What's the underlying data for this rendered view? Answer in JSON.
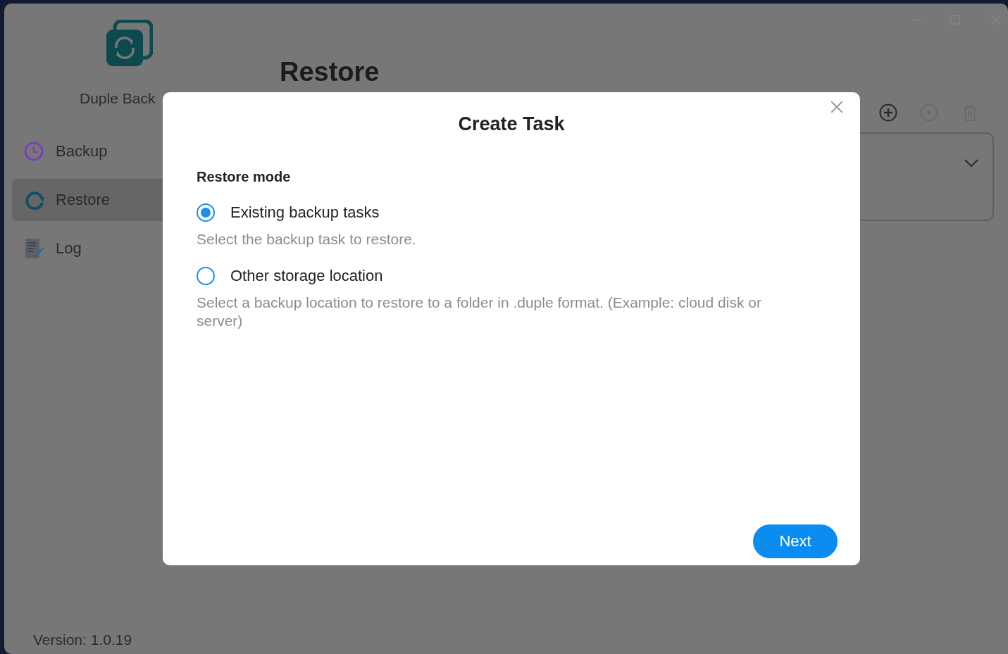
{
  "sidebar": {
    "app_name": "Duple Back",
    "items": [
      {
        "label": "Backup",
        "selected": false
      },
      {
        "label": "Restore",
        "selected": true
      },
      {
        "label": "Log",
        "selected": false
      }
    ],
    "version": "Version: 1.0.19"
  },
  "main": {
    "title": "Restore"
  },
  "dialog": {
    "title": "Create Task",
    "section_label": "Restore mode",
    "options": [
      {
        "label": "Existing backup tasks",
        "description": "Select the backup task to restore.",
        "selected": true
      },
      {
        "label": "Other storage location",
        "description": "Select a backup location to restore to a folder in .duple format. (Example: cloud disk or server)",
        "selected": false
      }
    ],
    "next_button": "Next"
  }
}
